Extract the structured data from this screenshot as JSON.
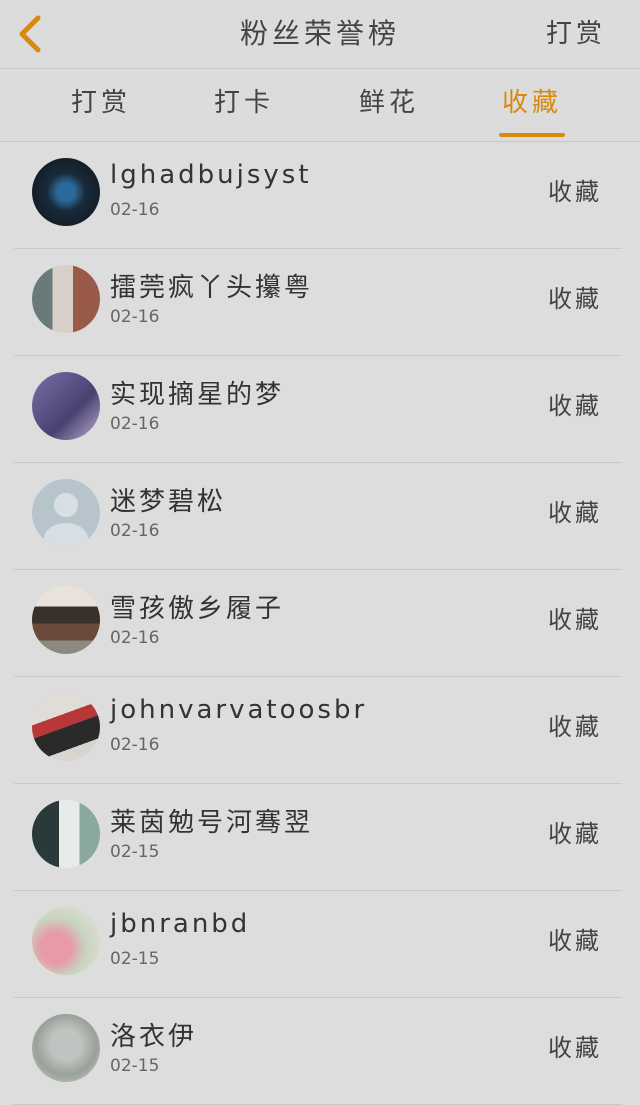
{
  "header": {
    "title": "粉丝荣誉榜",
    "right_action": "打赏"
  },
  "tabs": [
    {
      "label": "打赏"
    },
    {
      "label": "打卡"
    },
    {
      "label": "鲜花"
    },
    {
      "label": "收藏"
    }
  ],
  "active_tab": "收藏",
  "list": [
    {
      "name": "lghadbujsyst",
      "date": "02-16",
      "action": "收藏"
    },
    {
      "name": "擂莞疯丫头攥粤",
      "date": "02-16",
      "action": "收藏"
    },
    {
      "name": "实现摘星的梦",
      "date": "02-16",
      "action": "收藏"
    },
    {
      "name": "迷梦碧松",
      "date": "02-16",
      "action": "收藏"
    },
    {
      "name": "雪孩傲乡履子",
      "date": "02-16",
      "action": "收藏"
    },
    {
      "name": "johnvarvatoosbr",
      "date": "02-16",
      "action": "收藏"
    },
    {
      "name": "莱茵勉号河骞翌",
      "date": "02-15",
      "action": "收藏"
    },
    {
      "name": "jbnranbd",
      "date": "02-15",
      "action": "收藏"
    },
    {
      "name": "洛衣伊",
      "date": "02-15",
      "action": "收藏"
    }
  ],
  "colors": {
    "accent": "#d88a10",
    "background": "#dddddd"
  }
}
